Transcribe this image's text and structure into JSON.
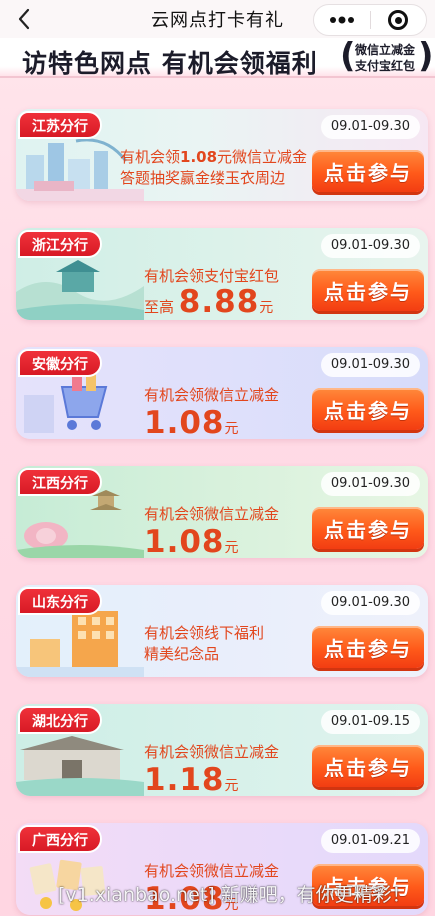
{
  "nav": {
    "title": "云网点打卡有礼",
    "back_icon": "‹",
    "more_icon": "•••"
  },
  "banner": {
    "title": "访特色网点 有机会领福利",
    "bracket_open": "(",
    "bracket_close": ")",
    "sub_line1": "微信立减金",
    "sub_line2": "支付宝红包"
  },
  "cards": [
    {
      "branch": "江苏分行",
      "date": "09.01-09.30",
      "line1_pre": "有机会领",
      "line1_amount": "1.08",
      "line1_post": "元微信立减金",
      "line2": "答题抽奖赢金缕玉衣周边",
      "cta": "点击参与",
      "bg": [
        "#dff3f1",
        "#f6e7f3"
      ]
    },
    {
      "branch": "浙江分行",
      "date": "09.01-09.30",
      "line1": "有机会领支付宝红包",
      "line2_pre": "至高",
      "amount": "8.88",
      "unit": "元",
      "cta": "点击参与",
      "bg": [
        "#cfeee6",
        "#e8f4ee"
      ]
    },
    {
      "branch": "安徽分行",
      "date": "09.01-09.30",
      "line1": "有机会领微信立减金",
      "amount": "1.08",
      "unit": "元",
      "cta": "点击参与",
      "bg": [
        "#e5e2fb",
        "#d7dcfa"
      ]
    },
    {
      "branch": "江西分行",
      "date": "09.01-09.30",
      "line1": "有机会领微信立减金",
      "amount": "1.08",
      "unit": "元",
      "cta": "点击参与",
      "bg": [
        "#c6ecd6",
        "#e7f6e4"
      ]
    },
    {
      "branch": "山东分行",
      "date": "09.01-09.30",
      "line1": "有机会领线下福利",
      "line2": "精美纪念品",
      "cta": "点击参与",
      "bg": [
        "#e3f0fb",
        "#eef1fb"
      ]
    },
    {
      "branch": "湖北分行",
      "date": "09.01-09.15",
      "line1": "有机会领微信立减金",
      "amount": "1.18",
      "unit": "元",
      "cta": "点击参与",
      "bg": [
        "#cdeee6",
        "#e0f3ee"
      ]
    },
    {
      "branch": "广西分行",
      "date": "09.01-09.21",
      "line1": "有机会领微信立减金",
      "amount": "1.08",
      "unit": "元",
      "cta": "点击参与",
      "bg": [
        "#f3dcf6",
        "#e3d9fb"
      ]
    }
  ],
  "watermark": "[v1.xianbao.net] 新赚吧，有你更精彩！"
}
